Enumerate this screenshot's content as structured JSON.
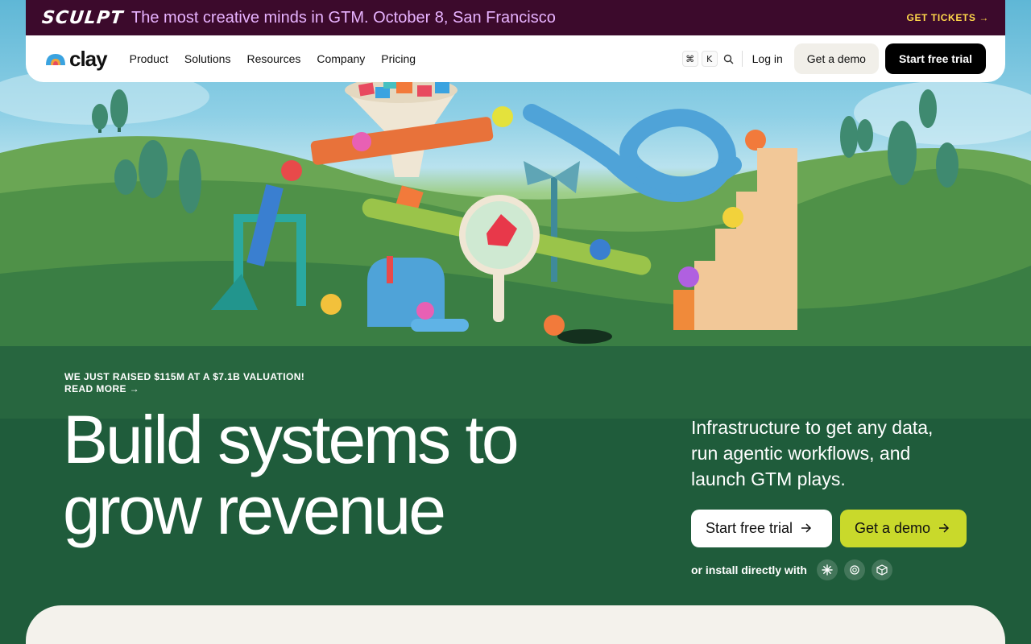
{
  "announcement": {
    "brand": "SCULPT",
    "text": "The most creative minds in GTM. October 8, San Francisco",
    "cta": "GET TICKETS →"
  },
  "nav": {
    "brand": "clay",
    "menu": [
      {
        "label": "Product"
      },
      {
        "label": "Solutions"
      },
      {
        "label": "Resources"
      },
      {
        "label": "Company"
      },
      {
        "label": "Pricing"
      }
    ],
    "shortcut": {
      "cmd": "⌘",
      "key": "K"
    },
    "login": "Log in",
    "demo": "Get a demo",
    "trial": "Start free trial"
  },
  "hero": {
    "raise_text": "WE JUST RAISED $115M AT A $7.1B VALUATION!",
    "read_more": "READ MORE →",
    "headline_line1": "Build systems to",
    "headline_line2": "grow revenue",
    "subhead": "Infrastructure to get any data, run agentic workflows, and launch GTM plays.",
    "cta_trial": "Start free trial",
    "cta_demo": "Get a demo",
    "install_text": "or install directly with",
    "integrations": [
      "claude-icon",
      "openai-icon",
      "cube-icon"
    ]
  },
  "colors": {
    "announce_bg": "#3c0a2c",
    "announce_text": "#e8b3ff",
    "tickets": "#ffd84a",
    "demo_accent": "#c9d92b",
    "hero_green": "#1f5c3b"
  }
}
